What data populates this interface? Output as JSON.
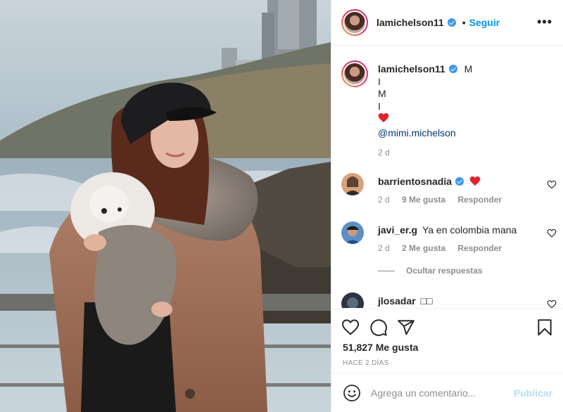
{
  "post": {
    "author": "lamichelson11",
    "follow_label": "Seguir",
    "more_icon": "more-horizontal-icon",
    "dot": "•"
  },
  "caption": {
    "author": "lamichelson11",
    "lines": [
      "M",
      "I",
      "M",
      "I"
    ],
    "heart": "❤️",
    "mention": "@mimi.michelson",
    "time": "2 d"
  },
  "comments": [
    {
      "user": "barrientosnadia",
      "verified": true,
      "text": "❤️",
      "time": "2 d",
      "likes": "9 Me gusta",
      "reply": "Responder"
    },
    {
      "user": "javi_er.g",
      "verified": false,
      "text": "Ya en colombia mana",
      "time": "2 d",
      "likes": "2 Me gusta",
      "reply": "Responder"
    },
    {
      "user": "jlosadar",
      "verified": false,
      "text": "□□",
      "time": "",
      "likes": "",
      "reply": ""
    }
  ],
  "replies": {
    "hide_label": "Ocultar respuestas"
  },
  "actions": {
    "like_icon": "heart-icon",
    "comment_icon": "comment-icon",
    "share_icon": "send-icon",
    "save_icon": "bookmark-icon",
    "likes": "51,827 Me gusta",
    "ago": "HACE 2 DÍAS"
  },
  "comment_box": {
    "placeholder": "Agrega un comentario...",
    "post_label": "Publicar",
    "emoji_icon": "smiley-icon"
  },
  "colors": {
    "accent": "#0095f6",
    "verified": "#3897f0",
    "heart": "#ed4956",
    "muted": "#8e8e8e"
  }
}
